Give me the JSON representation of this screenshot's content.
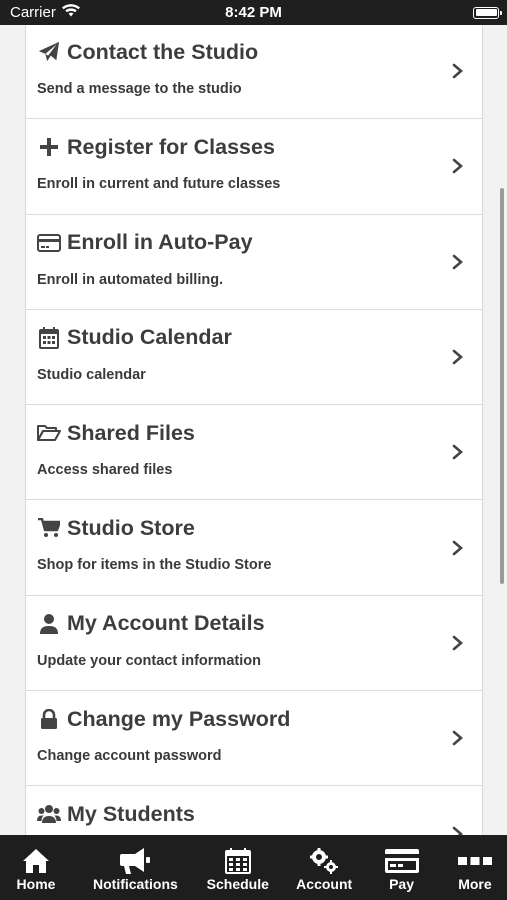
{
  "status": {
    "carrier": "Carrier",
    "time": "8:42 PM"
  },
  "menu": {
    "items": [
      {
        "title": "Contact the Studio",
        "subtitle": "Send a message to the studio",
        "icon": "paper-plane-icon"
      },
      {
        "title": "Register for Classes",
        "subtitle": "Enroll in current and future classes",
        "icon": "plus-icon"
      },
      {
        "title": "Enroll in Auto-Pay",
        "subtitle": "Enroll in automated billing.",
        "icon": "credit-card-icon"
      },
      {
        "title": "Studio Calendar",
        "subtitle": "Studio calendar",
        "icon": "calendar-icon"
      },
      {
        "title": "Shared Files",
        "subtitle": "Access shared files",
        "icon": "folder-open-icon"
      },
      {
        "title": "Studio Store",
        "subtitle": "Shop for items in the Studio Store",
        "icon": "shopping-cart-icon"
      },
      {
        "title": "My Account Details",
        "subtitle": "Update your contact information",
        "icon": "user-icon"
      },
      {
        "title": "Change my Password",
        "subtitle": "Change account password",
        "icon": "lock-icon"
      },
      {
        "title": "My Students",
        "subtitle": "",
        "icon": "users-icon"
      }
    ]
  },
  "tabbar": {
    "tabs": [
      {
        "label": "Home",
        "icon": "home-icon"
      },
      {
        "label": "Notifications",
        "icon": "megaphone-icon"
      },
      {
        "label": "Schedule",
        "icon": "calendar-grid-icon"
      },
      {
        "label": "Account",
        "icon": "gears-icon"
      },
      {
        "label": "Pay",
        "icon": "credit-card-icon"
      },
      {
        "label": "More",
        "icon": "more-dots-icon"
      }
    ]
  },
  "colors": {
    "bars": "#1e1e1e",
    "text": "#3d3d3d",
    "background": "#f2f2f2"
  }
}
